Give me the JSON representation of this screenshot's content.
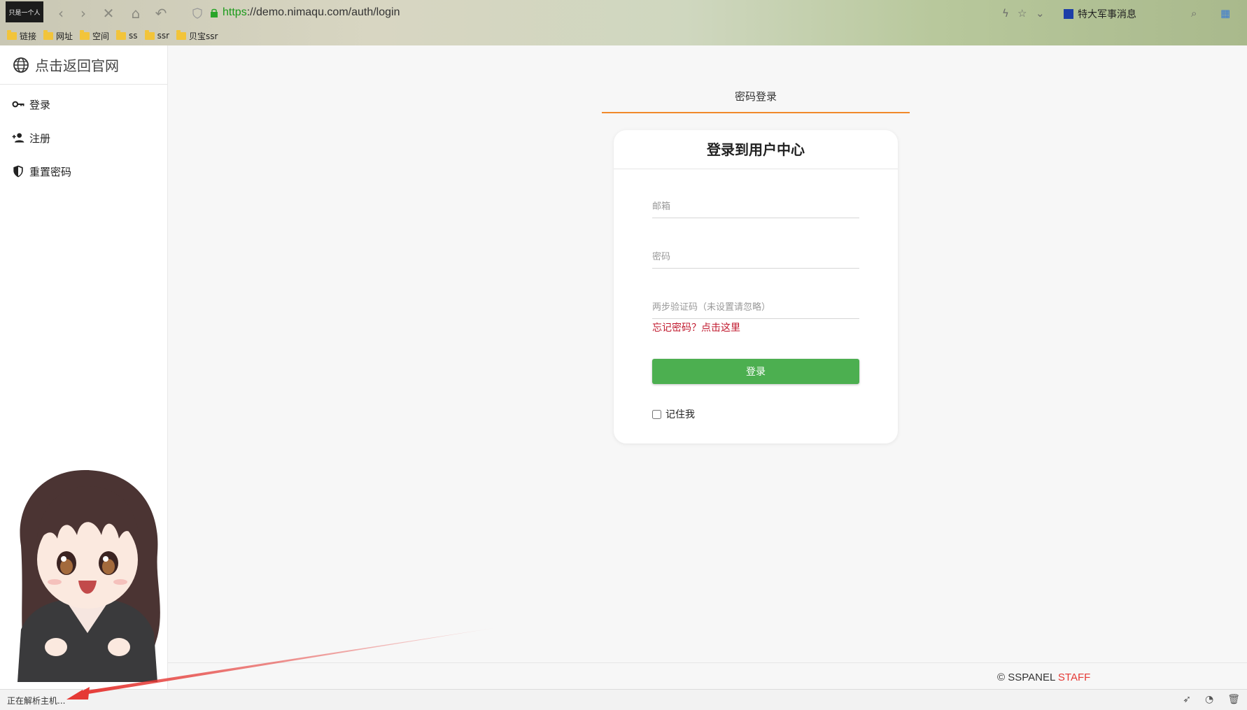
{
  "browser": {
    "avatar_text": "只是一个人",
    "url_scheme": "https",
    "url_rest": "://demo.nimaqu.com/auth/login",
    "news_label": "特大军事消息",
    "bookmarks": [
      "链接",
      "网址",
      "空间",
      "ss",
      "ssr",
      "贝宝ssr"
    ]
  },
  "sidebar": {
    "brand": "点击返回官网",
    "items": [
      {
        "label": "登录",
        "icon": "key-icon"
      },
      {
        "label": "注册",
        "icon": "add-user-icon"
      },
      {
        "label": "重置密码",
        "icon": "shield-icon"
      }
    ]
  },
  "login": {
    "tab_label": "密码登录",
    "title": "登录到用户中心",
    "email_placeholder": "邮箱",
    "password_placeholder": "密码",
    "twofa_placeholder": "两步验证码（未设置请忽略）",
    "forgot_text": "忘记密码？点击这里",
    "submit_label": "登录",
    "remember_label": "记住我"
  },
  "footer": {
    "copyright": "© SSPANEL ",
    "staff": "STAFF"
  },
  "status": {
    "text": "正在解析主机..."
  },
  "colors": {
    "accent_tab": "#f0892a",
    "button_green": "#4caf50",
    "link_red": "#c0182d",
    "staff_red": "#e53935"
  }
}
